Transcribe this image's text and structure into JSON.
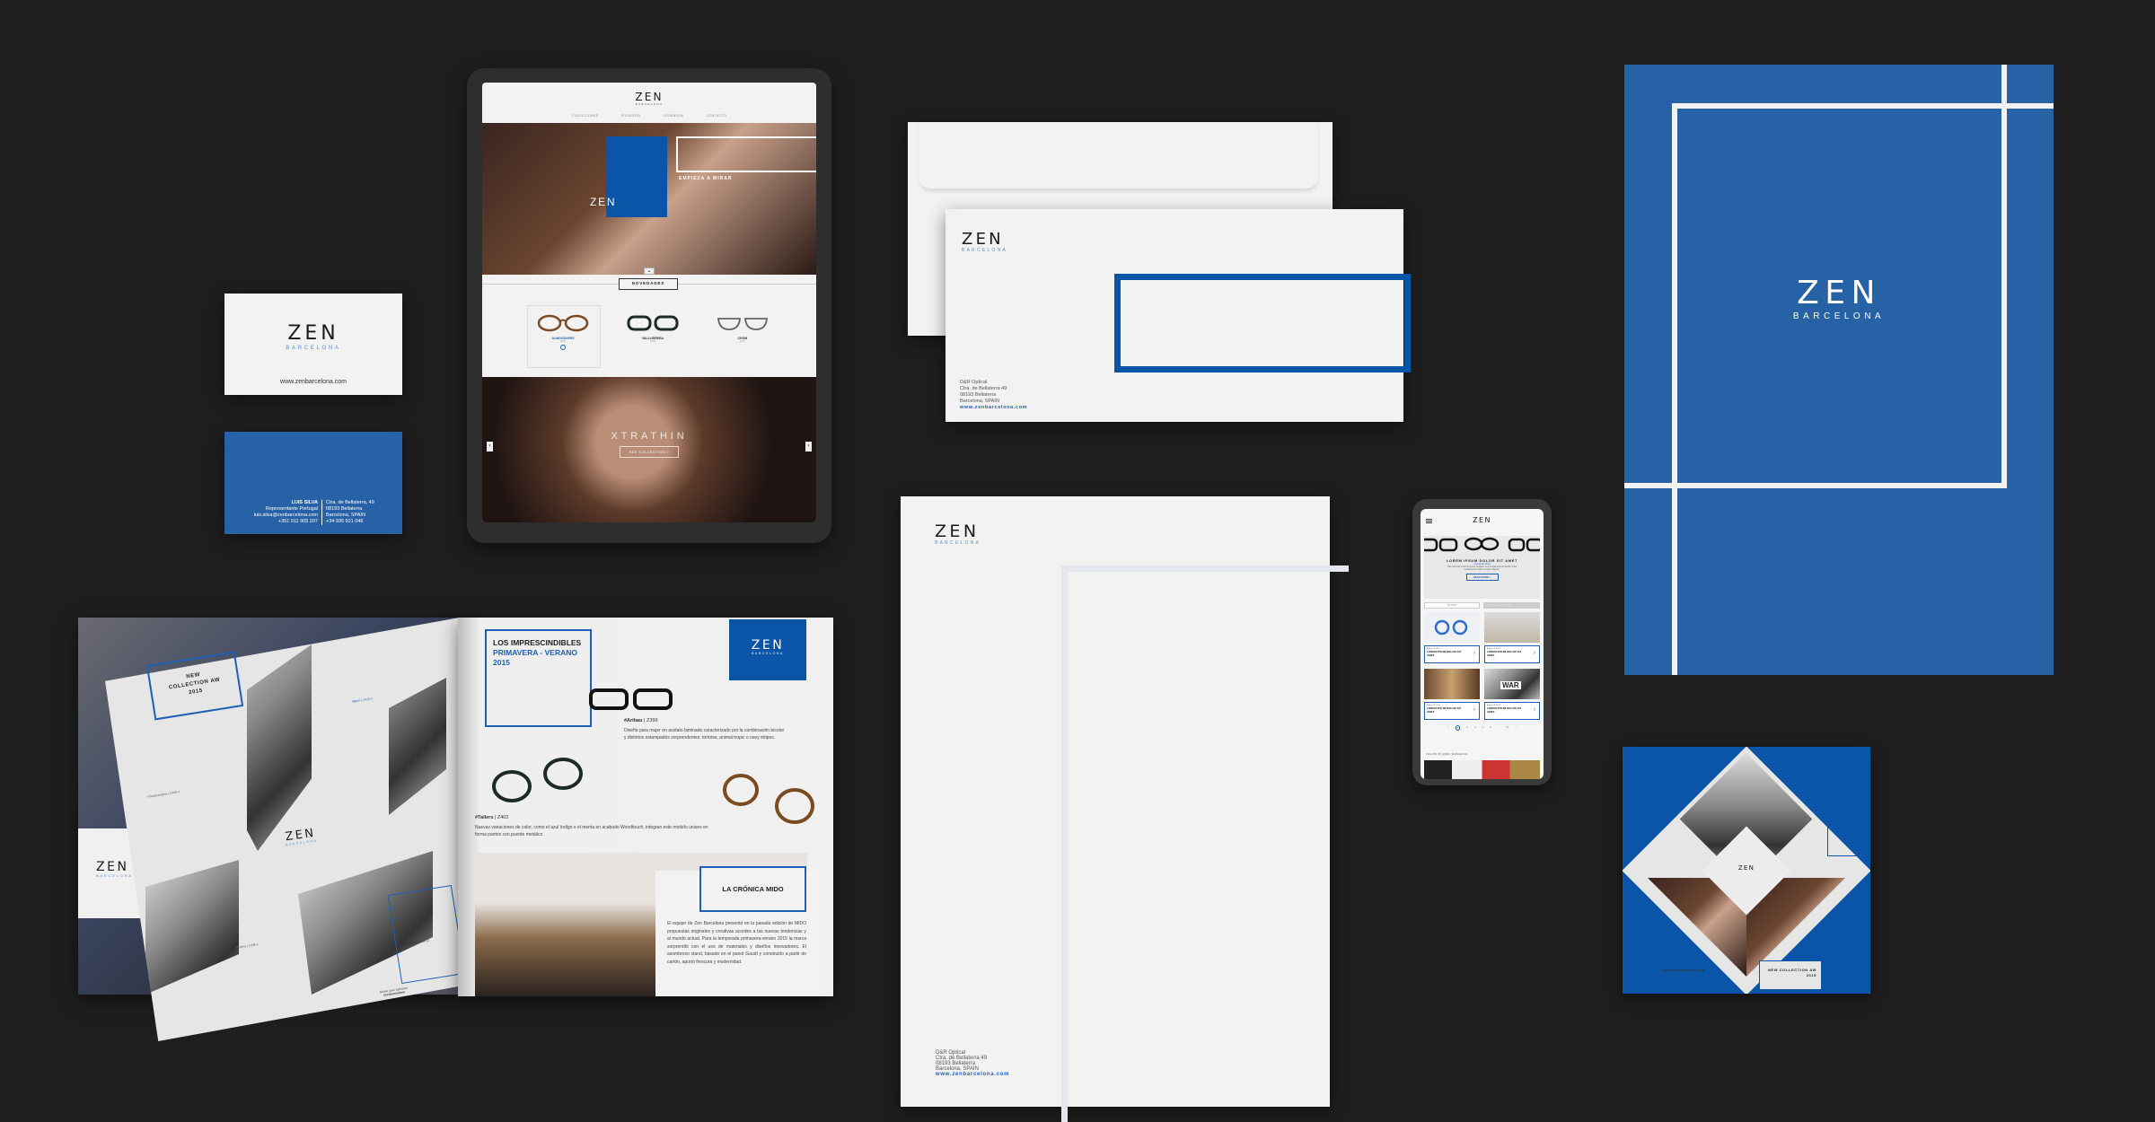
{
  "brand": {
    "name": "ZEN",
    "sub": "BARCELONA",
    "url": "www.zenbarcelona.com",
    "blue": "#2762a6",
    "blue_strong": "#0a55a8"
  },
  "business_card": {
    "front_url": "www.zenbarcelona.com",
    "back": {
      "name": "LUIS SILVA",
      "role": "Representante Portugal",
      "email": "luis.silva@zenbarcelona.com",
      "phone": "+351 911 905 207",
      "address": [
        "Ctra. de Bellaterra, 49",
        "08193 Bellaterra",
        "Barcelona, SPAIN",
        "+34 935 921 046"
      ]
    }
  },
  "tablet": {
    "nav": [
      "COLECCIONES",
      "FILOSOFÍA",
      "LOOKBOOK",
      "CONTACTO"
    ],
    "hero_cta": "EMPIEZA A MIRAR",
    "section_title": "NOVEDADES",
    "products": [
      {
        "name": "ALMOGÀVERS",
        "code": "Z360"
      },
      {
        "name": "VALLVIDRERA",
        "code": "Z359"
      },
      {
        "name": "CRÒM",
        "code": "Z367"
      }
    ],
    "banner_title": "XTRATHIN",
    "banner_button": "SEE COLLECTION >"
  },
  "stationery": {
    "company": "D&R Optical",
    "address": [
      "Ctra. de Bellaterra 49",
      "08193 Bellaterra",
      "Barcelona, SPAIN"
    ]
  },
  "phone": {
    "hero_title": "LOREM IPSUM DOLOR SIT AMET",
    "hero_date": "August 28, 2014",
    "hero_text": "Sed vehicula luctus id metus sodales, sed feugiat metus blandit. Nulla condimentum nibh a auctor aliquam.",
    "read_more": "READ MORE >",
    "filter": "FILTROS",
    "search_placeholder": "Búsqueda por nombre",
    "cards": [
      {
        "date": "August 28, 2014",
        "title": "LOREM IPSUM DOLOR SIT AMET"
      },
      {
        "date": "August 28, 2014",
        "title": "LOREM IPSUM DOLOR SIT AMET"
      },
      {
        "date": "August 28, 2014",
        "title": "LOREM IPSUM DOLOR SIT AMET"
      },
      {
        "date": "August 28, 2014",
        "title": "LOREM IPSUM DOLOR SIT AMET"
      }
    ],
    "war_sign": "WAR",
    "pagination": [
      "<",
      "1",
      "2",
      "3",
      "4",
      "5",
      "...",
      "23",
      ">"
    ],
    "follow": "FOLLOW US! @ZEN_BARCELONA"
  },
  "magazine": {
    "left": {
      "collection": "NEW COLLECTION AW 2015",
      "tags": [
        "#Tantarantana | Z409-4",
        "#Born | Z412-1",
        "#Palma | Z408-1",
        "#Paloma | Z407-2"
      ],
      "share": "Share your eyewear",
      "hashtag": "#zenbarcelona"
    },
    "right": {
      "heading_1": "LOS IMPRESCINDIBLES",
      "heading_2": "PRIMAVERA - VERANO 2015",
      "aribau_tag": "#Aribau",
      "aribau_code": "| Z399",
      "aribau_text": "Diseño para mujer en acetato laminado caracterizado por la combinación bicolor y distintos estampados sorprendentes: tortoise, animal tropic o navy stripes.",
      "tallers_tag": "#Tallers",
      "tallers_code": "| Z402",
      "tallers_text": "Nuevas variaciones de color, como el azul índigo o el menta en acabado Woodtouch, integran este modelo unisex en forma pantos con puente metálico.",
      "cronica_title": "LA CRÓNICA MIDO",
      "cronica_text": "El equipo de Zen Barcelona presentó en la pasada edición de MIDO propuestas originales y creativas acordes a las nuevas tendencias y al mundo actual. Para la temporada primavera-verano 2015 la marca sorprendió con el uso de materiales y diseños innovadores. El asombroso stand, basado en el panot Gaudí y construido a partir de cartón, aportó frescura y modernidad."
    }
  },
  "square_card": {
    "collection": "NEW COLLECTION AW 2015",
    "url": "www.zenbarcelona.com"
  }
}
